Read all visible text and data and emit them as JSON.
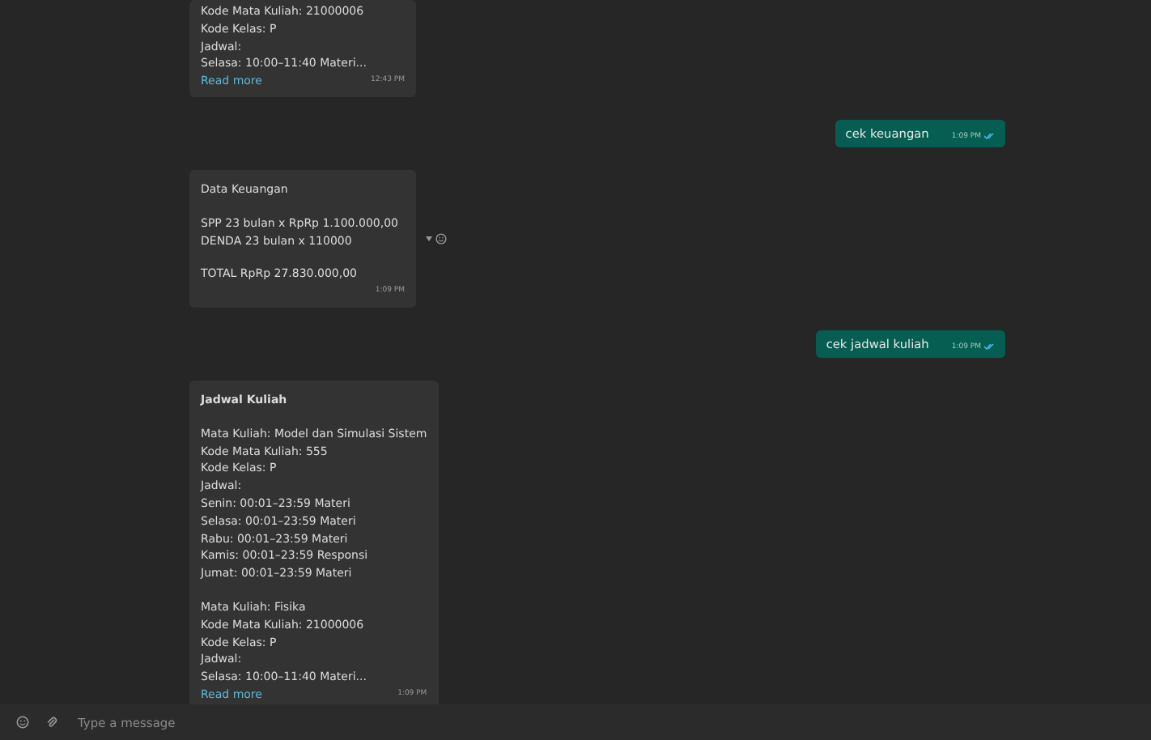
{
  "messages": [
    {
      "kind": "incoming",
      "paragraphs": [
        [
          "Kode Mata Kuliah: 21000006",
          "Kode Kelas: P",
          "Jadwal:",
          "Selasa: 10:00–11:40 Materi..."
        ]
      ],
      "read_more": "Read more",
      "time": "12:43 PM"
    },
    {
      "kind": "outgoing",
      "text": "cek keuangan",
      "time": "1:09 PM",
      "read": true
    },
    {
      "kind": "incoming",
      "paragraphs": [
        [
          "Data Keuangan"
        ],
        [
          "SPP 23 bulan x RpRp 1.100.000,00",
          "DENDA 23 bulan x 110000"
        ],
        [
          "TOTAL RpRp 27.830.000,00"
        ]
      ],
      "time": "1:09 PM",
      "reaction_button": true
    },
    {
      "kind": "outgoing",
      "text": "cek jadwal kuliah",
      "time": "1:09 PM",
      "read": true
    },
    {
      "kind": "incoming",
      "title": "Jadwal Kuliah",
      "paragraphs": [
        [
          "Mata Kuliah: Model dan Simulasi Sistem",
          "Kode Mata Kuliah: 555",
          "Kode Kelas: P",
          "Jadwal:",
          "Senin: 00:01–23:59 Materi",
          "Selasa: 00:01–23:59 Materi",
          "Rabu: 00:01–23:59 Materi",
          "Kamis: 00:01–23:59 Responsi",
          "Jumat: 00:01–23:59 Materi"
        ],
        [
          "Mata Kuliah: Fisika",
          "Kode Mata Kuliah: 21000006",
          "Kode Kelas: P",
          "Jadwal:",
          "Selasa: 10:00–11:40 Materi..."
        ]
      ],
      "read_more": "Read more",
      "time": "1:09 PM"
    }
  ],
  "composer": {
    "placeholder": "Type a message"
  }
}
